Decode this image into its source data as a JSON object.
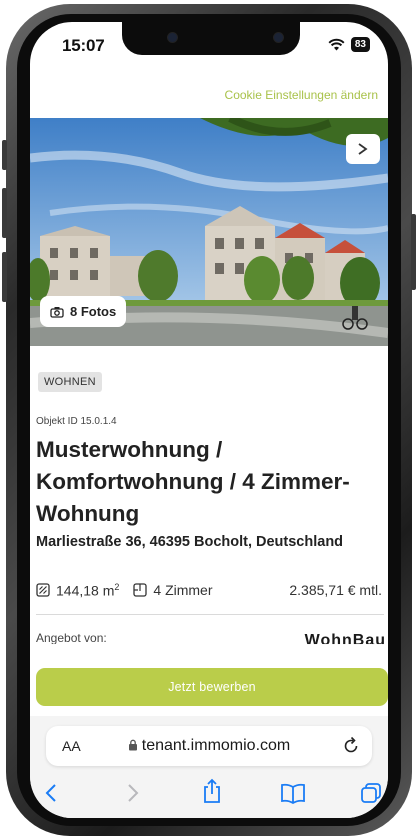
{
  "status_bar": {
    "time": "15:07",
    "battery": "83"
  },
  "page": {
    "cookie_link": "Cookie Einstellungen ändern",
    "photos_label": "8 Fotos",
    "tag": "WOHNEN",
    "object_id": "Objekt ID 15.0.1.4",
    "title": "Musterwohnung / Komfortwohnung / 4 Zimmer-Wohnung",
    "address": "Marliestraße 36, 46395 Bocholt, Deutschland",
    "facts": {
      "area_value": "144,18 m",
      "area_unit_sup": "2",
      "rooms": "4 Zimmer",
      "price": "2.385,71 € mtl."
    },
    "offer_label": "Angebot von:",
    "provider_logo": "WohnBau",
    "cta_label": "Jetzt bewerben"
  },
  "browser": {
    "text_size_label": "AA",
    "url": "tenant.immomio.com",
    "icons": [
      "back-icon",
      "forward-icon",
      "share-icon",
      "bookmarks-icon",
      "tabs-icon",
      "reload-icon",
      "lock-icon"
    ],
    "accent_color": "#1a7cf5"
  },
  "colors": {
    "brand_green": "#bacd4a",
    "cookie_link": "#a9c24a"
  }
}
